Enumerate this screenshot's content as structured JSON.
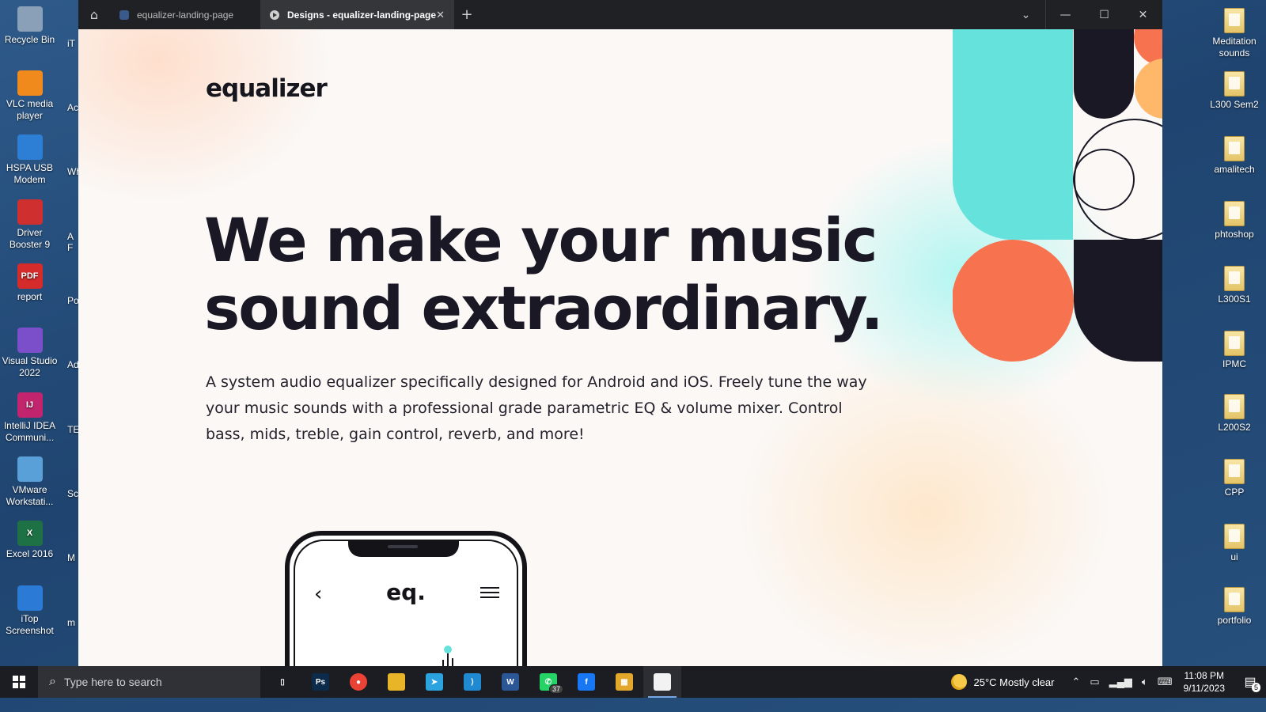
{
  "desktop_left": [
    {
      "label": "Recycle Bin",
      "icon": "recycle-bin-icon",
      "color": "#8aa0b8"
    },
    {
      "label": "VLC media player",
      "icon": "vlc-icon",
      "color": "#f08a1c"
    },
    {
      "label": "HSPA USB Modem",
      "icon": "modem-icon",
      "color": "#2d7fd6"
    },
    {
      "label": "Driver Booster 9",
      "icon": "driver-booster-icon",
      "color": "#d02f2f"
    },
    {
      "label": "report",
      "icon": "pdf-icon",
      "color": "#d62b2b",
      "glyph": "PDF"
    },
    {
      "label": "Visual Studio 2022",
      "icon": "visual-studio-icon",
      "color": "#7b4fc9"
    },
    {
      "label": "IntelliJ IDEA Communi...",
      "icon": "intellij-icon",
      "color": "#c2246e",
      "glyph": "IJ"
    },
    {
      "label": "VMware Workstati...",
      "icon": "vmware-icon",
      "color": "#5aa0d8"
    },
    {
      "label": "Excel 2016",
      "icon": "excel-icon",
      "color": "#1e7145",
      "glyph": "X"
    },
    {
      "label": "iTop Screenshot",
      "icon": "itop-screenshot-icon",
      "color": "#2a7ad6"
    }
  ],
  "desktop_partial": [
    "iT",
    "Ac",
    "Wh",
    "A F",
    "Pov",
    "Adb",
    "TE",
    "Sc",
    "M",
    "m"
  ],
  "desktop_right": [
    {
      "label": "Meditation sounds"
    },
    {
      "label": "L300 Sem2"
    },
    {
      "label": "amalitech"
    },
    {
      "label": "phtoshop"
    },
    {
      "label": "L300S1"
    },
    {
      "label": "IPMC"
    },
    {
      "label": "L200S2"
    },
    {
      "label": "CPP"
    },
    {
      "label": "ui"
    },
    {
      "label": "portfolio"
    }
  ],
  "browser": {
    "tabs": [
      {
        "label": "equalizer-landing-page",
        "active": false
      },
      {
        "label": "Designs - equalizer-landing-page",
        "active": true
      }
    ],
    "close_symbol": "✕",
    "new_tab_symbol": "+"
  },
  "page": {
    "logo": "equalizer",
    "headline_line1": "We make your music",
    "headline_line2": "sound extraordinary.",
    "description": "A system audio equalizer specifically designed for Android and iOS. Freely tune the way your music sounds with a professional grade parametric EQ & volume mixer. Control bass, mids, treble, gain control, reverb, and more!",
    "phone": {
      "logo": "eq.",
      "back_symbol": "‹"
    },
    "colors": {
      "navy": "#191824",
      "cyan": "#66e2dc",
      "coral": "#f7734f",
      "peach": "#ffb86a"
    }
  },
  "taskbar": {
    "search_placeholder": "Type here to search",
    "apps": [
      {
        "name": "task-view",
        "color": "#1b1d22",
        "glyph": "▯"
      },
      {
        "name": "photoshop",
        "color": "#0c2a4a",
        "glyph": "Ps"
      },
      {
        "name": "chrome",
        "color": "#ea4335",
        "glyph": "●"
      },
      {
        "name": "file-explorer",
        "color": "#e8b528",
        "glyph": ""
      },
      {
        "name": "telegram",
        "color": "#2aa3df",
        "glyph": "➤"
      },
      {
        "name": "vscode",
        "color": "#1f8ad2",
        "glyph": "⟩"
      },
      {
        "name": "word",
        "color": "#2b5797",
        "glyph": "W"
      },
      {
        "name": "whatsapp",
        "color": "#25d366",
        "glyph": "✆"
      },
      {
        "name": "facebook",
        "color": "#1877f2",
        "glyph": "f"
      },
      {
        "name": "app-store",
        "color": "#e2a72b",
        "glyph": "▦"
      },
      {
        "name": "document",
        "color": "#f2f2f2",
        "glyph": ""
      }
    ],
    "whatsapp_badge": "37",
    "weather": "25°C  Mostly clear",
    "time": "11:08 PM",
    "date": "9/11/2023",
    "notifications": "5"
  }
}
